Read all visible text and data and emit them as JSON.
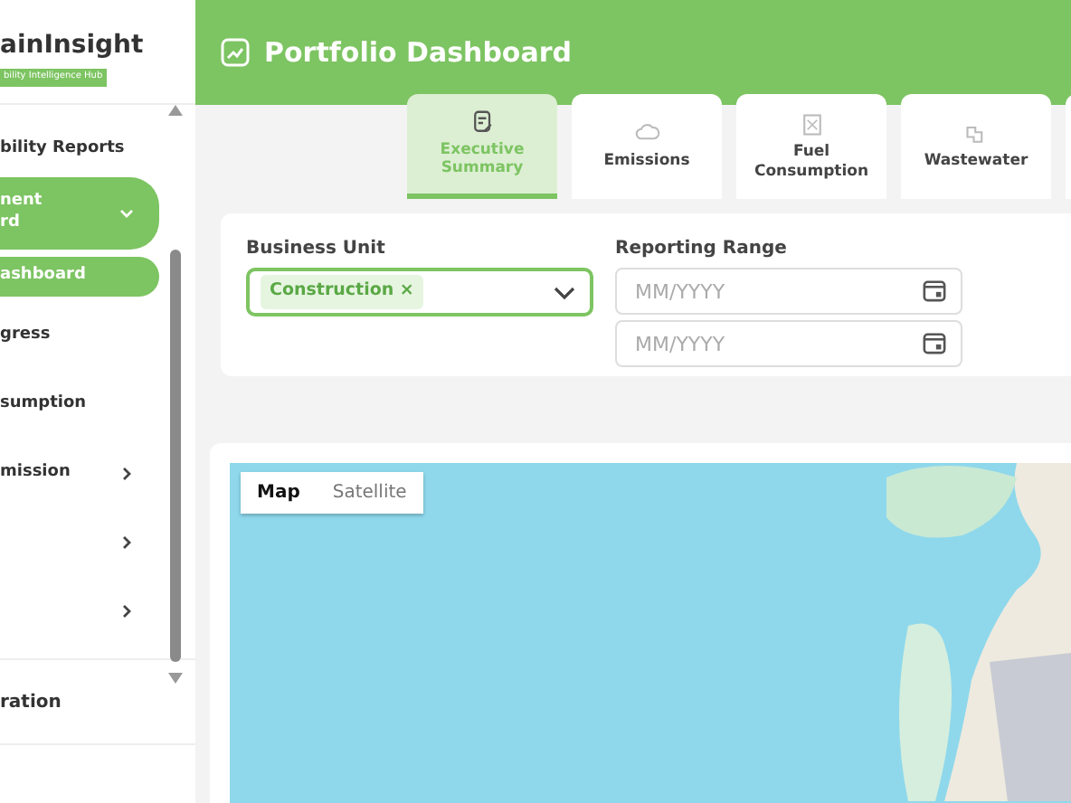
{
  "sidebar": {
    "logo": {
      "name": "ainInsight",
      "tagline": "bility Intelligence Hub"
    },
    "items": [
      {
        "label": "bility Reports",
        "kind": "heading",
        "selected": false
      },
      {
        "label": "nent\nrd",
        "kind": "group",
        "selected": true,
        "expanded": true
      },
      {
        "label": "ashboard",
        "kind": "sub",
        "selected": true
      },
      {
        "label": "gress",
        "kind": "item",
        "selected": false
      },
      {
        "label": "sumption",
        "kind": "item",
        "selected": false
      },
      {
        "label": "mission",
        "kind": "item",
        "selected": false,
        "expanded": false
      },
      {
        "kind": "item",
        "selected": false,
        "expanded": false
      },
      {
        "kind": "item",
        "selected": false,
        "expanded": false
      }
    ],
    "footer": "ration"
  },
  "header": {
    "title": "Portfolio Dashboard"
  },
  "tabs": [
    {
      "label": "Executive\nSummary",
      "selected": true
    },
    {
      "label": "Emissions",
      "selected": false
    },
    {
      "label": "Fuel\nConsumption",
      "selected": false
    },
    {
      "label": "Wastewater",
      "selected": false
    }
  ],
  "filters": {
    "business_unit": {
      "label": "Business Unit",
      "focused": true,
      "tags": [
        {
          "text": "Construction",
          "remove": "×"
        }
      ]
    },
    "reporting_range": {
      "label": "Reporting Range",
      "fields": [
        {
          "placeholder": "MM/YYYY"
        },
        {
          "placeholder": "MM/YYYY"
        }
      ]
    }
  },
  "map": {
    "types": [
      {
        "label": "Map",
        "selected": true
      },
      {
        "label": "Satellite",
        "selected": false
      }
    ]
  }
}
